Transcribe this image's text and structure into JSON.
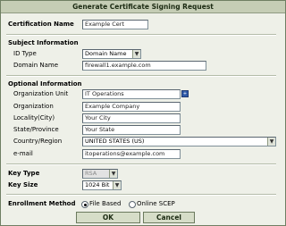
{
  "dialog": {
    "title": "Generate Certificate Signing Request",
    "certificate_name": {
      "label": "Certification Name",
      "value": "Example Cert"
    }
  },
  "subject": {
    "heading": "Subject Information",
    "id_type": {
      "label": "ID Type",
      "value": "Domain Name"
    },
    "domain_name": {
      "label": "Domain Name",
      "value": "firewall1.example.com"
    }
  },
  "optional": {
    "heading": "Optional Information",
    "org_unit": {
      "label": "Organization Unit",
      "value": "IT Operations"
    },
    "organization": {
      "label": "Organization",
      "value": "Example Company"
    },
    "locality": {
      "label": "Locality(City)",
      "value": "Your City"
    },
    "state": {
      "label": "State/Province",
      "value": "Your State"
    },
    "country": {
      "label": "Country/Region",
      "value": "UNITED STATES (US)"
    },
    "email": {
      "label": "e-mail",
      "value": "itoperations@example.com"
    }
  },
  "key": {
    "type": {
      "label": "Key Type",
      "value": "RSA"
    },
    "size": {
      "label": "Key Size",
      "value": "1024 Bit"
    }
  },
  "enrollment": {
    "label": "Enrollment Method",
    "file_based": "File Based",
    "online_scep": "Online SCEP",
    "selected": "File Based"
  },
  "buttons": {
    "ok": "OK",
    "cancel": "Cancel"
  },
  "icons": {
    "add_org_unit": "plus-icon",
    "dropdown": "chevron-down-icon",
    "radio": "radio-icon"
  }
}
